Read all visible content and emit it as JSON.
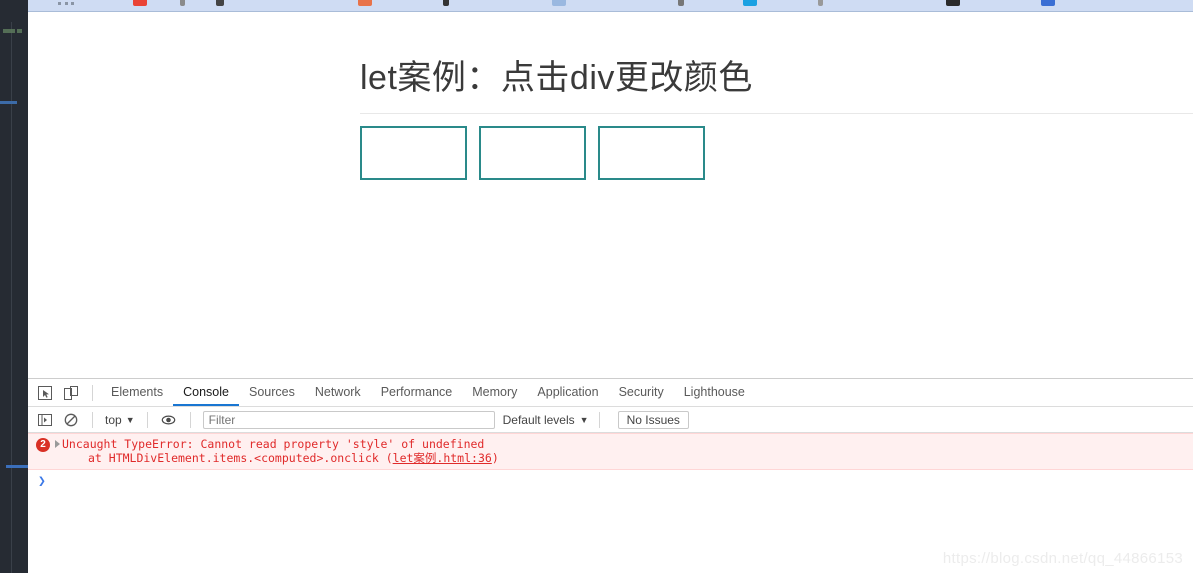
{
  "browser": {
    "bookmarks_bar": {
      "name": "bookmarks-bar",
      "items": [
        "",
        "",
        "",
        "",
        "",
        "",
        "",
        "",
        "",
        "",
        "",
        "",
        "",
        ""
      ]
    }
  },
  "page": {
    "title": "let案例：点击div更改颜色",
    "boxes": [
      {
        "label": "",
        "border_color": "#2a8a8a"
      },
      {
        "label": "",
        "border_color": "#2a8a8a"
      },
      {
        "label": "",
        "border_color": "#2a8a8a"
      }
    ]
  },
  "devtools": {
    "inspect_icon": "inspect-element-icon",
    "device_icon": "device-toolbar-icon",
    "tabs": [
      {
        "label": "Elements",
        "active": false
      },
      {
        "label": "Console",
        "active": true
      },
      {
        "label": "Sources",
        "active": false
      },
      {
        "label": "Network",
        "active": false
      },
      {
        "label": "Performance",
        "active": false
      },
      {
        "label": "Memory",
        "active": false
      },
      {
        "label": "Application",
        "active": false
      },
      {
        "label": "Security",
        "active": false
      },
      {
        "label": "Lighthouse",
        "active": false
      }
    ],
    "active_tab_underline_color": "#1976d2",
    "console_toolbar": {
      "sidebar_toggle_icon": "console-sidebar-icon",
      "clear_icon": "clear-console-icon",
      "context": "top",
      "context_caret": "▼",
      "eye_icon": "live-expression-eye-icon",
      "filter_placeholder": "Filter",
      "filter_value": "",
      "levels_label": "Default levels",
      "levels_caret": "▼",
      "issues_label": "No Issues"
    },
    "console_messages": [
      {
        "type": "error",
        "count": "2",
        "expand_caret": "▶",
        "line1": "Uncaught TypeError: Cannot read property 'style' of undefined",
        "line2_prefix": "at HTMLDivElement.items.<computed>.onclick (",
        "line2_link": "let案例.html:36",
        "line2_suffix": ")",
        "color": "#e02a2a",
        "background": "#fff0f0"
      }
    ],
    "prompt_caret": "❯"
  },
  "watermark": "https://blog.csdn.net/qq_44866153"
}
